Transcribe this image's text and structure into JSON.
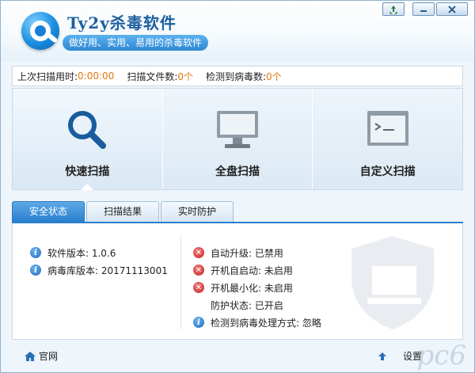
{
  "header": {
    "title": "Ty2y杀毒软件",
    "subtitle": "做好用、实用、易用的杀毒软件",
    "window_buttons": [
      "recycle-icon",
      "minimize-icon",
      "close-icon"
    ]
  },
  "stats": [
    {
      "label": "上次扫描用时:",
      "value": "0:00:00"
    },
    {
      "label": "扫描文件数:",
      "value": "0个"
    },
    {
      "label": "检测到病毒数:",
      "value": "0个"
    }
  ],
  "scan_options": [
    {
      "label": "快速扫描",
      "icon": "magnifier-icon",
      "active": true
    },
    {
      "label": "全盘扫描",
      "icon": "monitor-icon",
      "active": false
    },
    {
      "label": "自定义扫描",
      "icon": "terminal-window-icon",
      "active": false
    }
  ],
  "tabs": [
    {
      "label": "安全状态",
      "active": true
    },
    {
      "label": "扫描结果",
      "active": false
    },
    {
      "label": "实时防护",
      "active": false
    }
  ],
  "status_left": [
    {
      "icon": "info-icon",
      "text": "软件版本:  1.0.6"
    },
    {
      "icon": "info-icon",
      "text": "病毒库版本:  20171113001"
    }
  ],
  "status_right": [
    {
      "icon": "error-icon",
      "text": "自动升级:  已禁用"
    },
    {
      "icon": "error-icon",
      "text": "开机自启动:  未启用"
    },
    {
      "icon": "error-icon",
      "text": "开机最小化:  未启用"
    },
    {
      "icon": "",
      "text": "防护状态:  已开启"
    },
    {
      "icon": "info-icon",
      "text": "检测到病毒处理方式:  忽略"
    }
  ],
  "footer": {
    "home_label": "官网",
    "settings_label": "设置",
    "watermark": "pc6"
  },
  "colors": {
    "accent": "#2a7fce",
    "stat_value": "#e07a10",
    "error": "#c81e1e",
    "info": "#1f6cc0"
  }
}
